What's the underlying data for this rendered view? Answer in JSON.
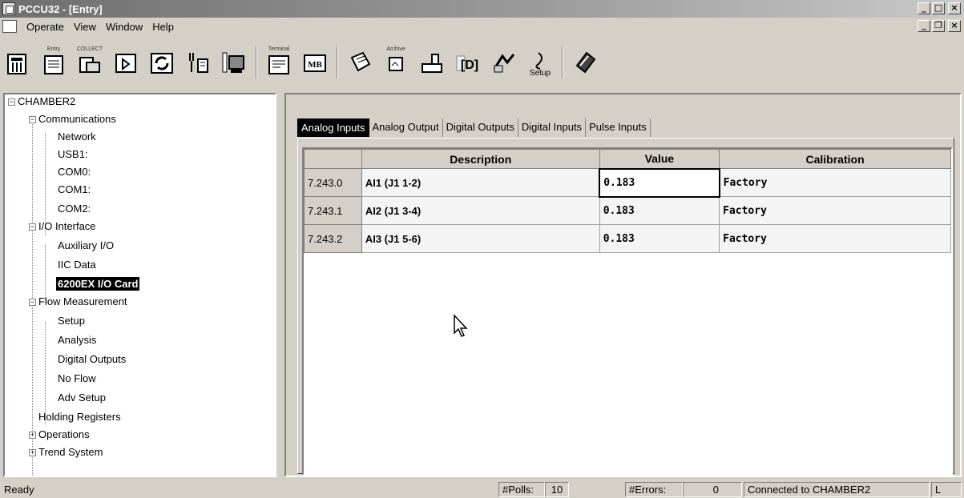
{
  "window": {
    "title": "PCCU32 - [Entry]"
  },
  "menu": [
    "Operate",
    "View",
    "Window",
    "Help"
  ],
  "toolbar": {
    "entry_cap": "Entry",
    "collect_cap": "COLLECT",
    "terminal_cap": "Terminal",
    "mb_label": "MB",
    "archive_cap": "Archive",
    "setup_label": "Setup"
  },
  "tree": {
    "root": "CHAMBER2",
    "communications": "Communications",
    "network": "Network",
    "usb1": "USB1:",
    "com0": "COM0:",
    "com1": "COM1:",
    "com2": "COM2:",
    "io_interface": "I/O Interface",
    "aux_io": "Auxiliary I/O",
    "iic_data": "IIC Data",
    "card": "6200EX I/O Card",
    "flow_measurement": "Flow Measurement",
    "setup": "Setup",
    "analysis": "Analysis",
    "digital_outputs": "Digital Outputs",
    "no_flow": "No Flow",
    "adv_setup": "Adv Setup",
    "holding_registers": "Holding Registers",
    "operations": "Operations",
    "trend_system": "Trend System"
  },
  "tabs": [
    "Analog Inputs",
    "Analog Output",
    "Digital Outputs",
    "Digital Inputs",
    "Pulse Inputs"
  ],
  "grid": {
    "headers": {
      "description": "Description",
      "value": "Value",
      "calibration": "Calibration"
    },
    "rows": [
      {
        "id": "7.243.0",
        "description": "AI1 (J1 1-2)",
        "value": "0.183",
        "calibration": "Factory"
      },
      {
        "id": "7.243.1",
        "description": "AI2 (J1 3-4)",
        "value": "0.183",
        "calibration": "Factory"
      },
      {
        "id": "7.243.2",
        "description": "AI3 (J1 5-6)",
        "value": "0.183",
        "calibration": "Factory"
      }
    ]
  },
  "status": {
    "ready": "Ready",
    "polls_label": "#Polls:",
    "polls_value": "10",
    "errors_label": "#Errors:",
    "errors_value": "0",
    "connection": "Connected to CHAMBER2",
    "mode": "L"
  }
}
